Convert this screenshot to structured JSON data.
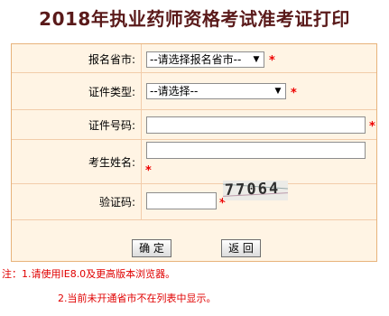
{
  "page": {
    "title": "2018年执业药师资格考试准考证打印"
  },
  "form": {
    "province": {
      "label": "报名省市:",
      "value": "--请选择报名省市--",
      "required_mark": "*"
    },
    "id_type": {
      "label": "证件类型:",
      "value": "--请选择--",
      "required_mark": "*"
    },
    "id_number": {
      "label": "证件号码:",
      "value": "",
      "required_mark": "*"
    },
    "name": {
      "label": "考生姓名:",
      "value": "",
      "required_mark": "*"
    },
    "captcha": {
      "label": "验证码:",
      "value": "",
      "required_mark": "*",
      "image_text": "77064"
    }
  },
  "buttons": {
    "confirm": "确 定",
    "back": "返 回"
  },
  "notes": {
    "line1": "注：1.请使用IE8.0及更高版本浏览器。",
    "line2": "2.当前未开通省市不在列表中显示。"
  },
  "colors": {
    "form_background": "#fff4e4",
    "form_border": "#e8b37b",
    "required": "#ee0000",
    "title": "#5a1a1a"
  },
  "icons": {
    "dropdown": "chevron-down-icon"
  }
}
